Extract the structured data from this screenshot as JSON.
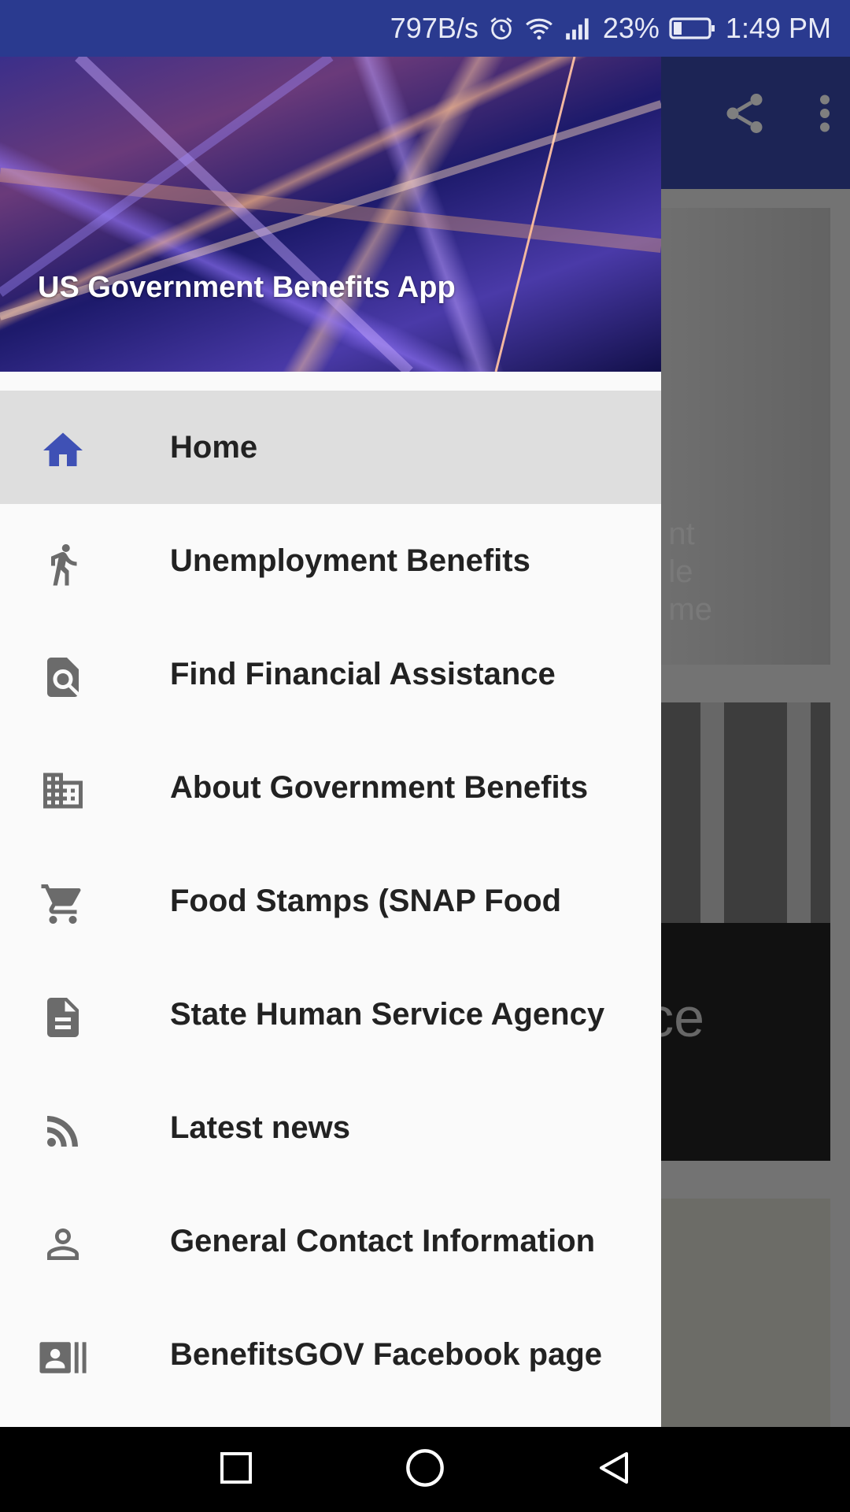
{
  "status_bar": {
    "net_speed": "797B/s",
    "battery_percent": "23%",
    "time": "1:49 PM",
    "icons": [
      "alarm-icon",
      "wifi-icon",
      "signal-icon",
      "battery-icon"
    ]
  },
  "background_app": {
    "actions": [
      "share-icon",
      "more-vert-icon"
    ],
    "card1_text": [
      "nt",
      "le",
      "me"
    ],
    "card2_text": "ce"
  },
  "drawer": {
    "title": "US Government Benefits App",
    "items": [
      {
        "label": "Home",
        "icon": "home-icon",
        "active": true
      },
      {
        "label": "Unemployment Benefits",
        "icon": "walking-person-icon",
        "active": false
      },
      {
        "label": "Find Financial Assistance",
        "icon": "find-in-page-icon",
        "active": false
      },
      {
        "label": "About Government Benefits",
        "icon": "business-icon",
        "active": false
      },
      {
        "label": "Food Stamps (SNAP Food",
        "icon": "shopping-cart-icon",
        "active": false
      },
      {
        "label": "State Human Service Agency",
        "icon": "document-icon",
        "active": false
      },
      {
        "label": "Latest news",
        "icon": "rss-feed-icon",
        "active": false
      },
      {
        "label": "General Contact Information",
        "icon": "person-outline-icon",
        "active": false
      },
      {
        "label": "BenefitsGOV Facebook page",
        "icon": "contact-card-icon",
        "active": false
      }
    ]
  },
  "nav_bar": {
    "buttons": [
      "recents-button",
      "home-button",
      "back-button"
    ]
  },
  "colors": {
    "status_bar": "#2a3a8f",
    "app_bar": "#3949ab",
    "active_icon": "#3f51b5",
    "icon_gray": "#6b6b6b",
    "active_row": "#dedede"
  }
}
